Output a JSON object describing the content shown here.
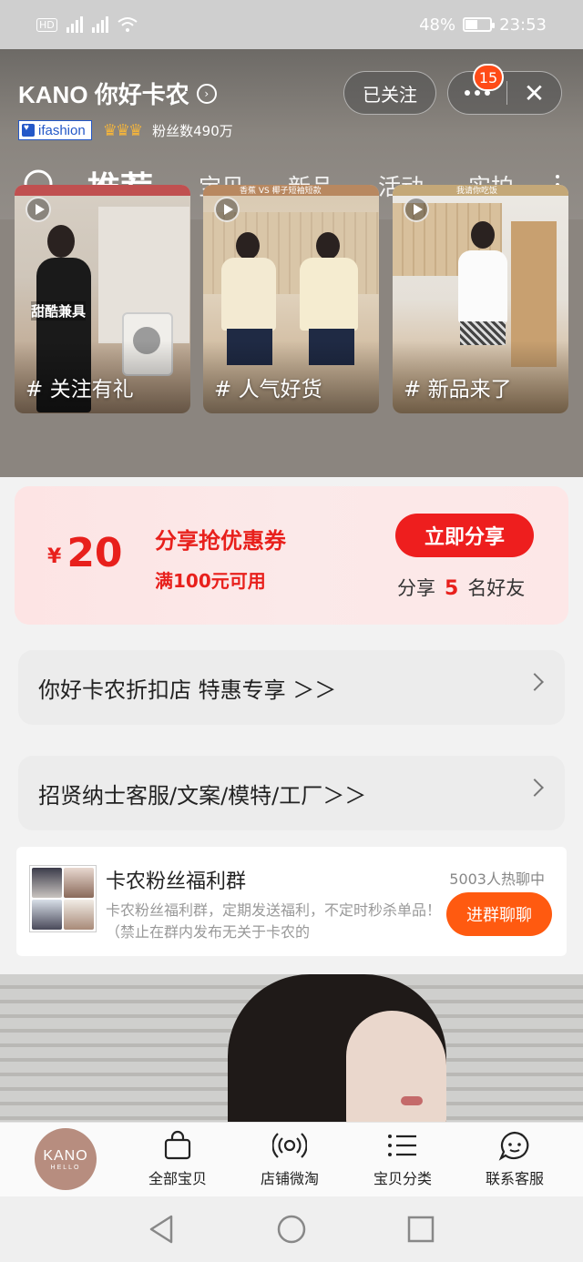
{
  "status_bar": {
    "signal_1": "4G",
    "signal_2": "4G",
    "hd": "HD",
    "battery": "48%",
    "time": "23:53"
  },
  "shop": {
    "name": "KANO 你好卡农",
    "ifashion": "ifashion",
    "fans": "粉丝数490万",
    "follow_label": "已关注",
    "badge_count": "15"
  },
  "nav": {
    "tabs": [
      "推荐",
      "宝贝",
      "新品",
      "活动",
      "实拍"
    ]
  },
  "videos": [
    {
      "caption": "# 关注有礼",
      "overlay": "甜酷兼具"
    },
    {
      "caption": "# 人气好货",
      "overlay": "香蕉 VS 椰子短袖短款"
    },
    {
      "caption": "# 新品来了",
      "overlay": "我请你吃饭"
    }
  ],
  "coupon": {
    "currency": "¥",
    "amount": "20",
    "title": "分享抢优惠券",
    "condition": "满100元可用",
    "button": "立即分享",
    "share_prefix": "分享",
    "share_count": "5",
    "share_suffix": "名好友"
  },
  "links": [
    {
      "text": "你好卡农折扣店 特惠专享 ＞＞"
    },
    {
      "text": "招贤纳士客服/文案/模特/工厂＞＞"
    }
  ],
  "group": {
    "title": "卡农粉丝福利群",
    "description": "卡农粉丝福利群，定期发送福利，不定时秒杀单品！（禁止在群内发布无关于卡农的",
    "count": "5003人热聊中",
    "button": "进群聊聊"
  },
  "tabbar": {
    "logo_line1": "KANO",
    "logo_line2": "HELLO",
    "items": [
      {
        "label": "全部宝贝",
        "icon": "shopping-bag-icon"
      },
      {
        "label": "店铺微淘",
        "icon": "broadcast-icon"
      },
      {
        "label": "宝贝分类",
        "icon": "list-icon"
      },
      {
        "label": "联系客服",
        "icon": "chat-bubble-icon"
      }
    ]
  },
  "colors": {
    "accent_red": "#e8201c",
    "orange": "#ff5a10",
    "brand_logo": "#b78d7f"
  }
}
